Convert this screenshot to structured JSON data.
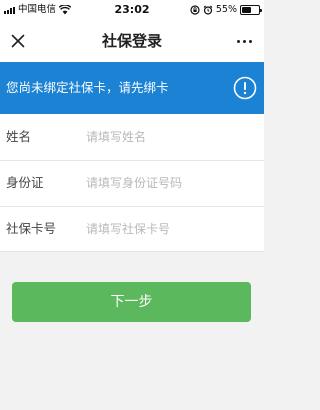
{
  "status_bar": {
    "carrier": "中国电信",
    "time": "23:02",
    "battery_percent": "55%",
    "battery_level": 0.55,
    "icons": [
      "signal-icon",
      "wifi-icon",
      "rotation-lock-icon",
      "alarm-icon",
      "battery-icon"
    ]
  },
  "nav": {
    "title": "社保登录",
    "close_icon": "close-icon",
    "more_icon": "more-icon"
  },
  "notice": {
    "text": "您尚未绑定社保卡，请先绑卡",
    "icon": "alert-icon",
    "background": "#1b82d4"
  },
  "form": {
    "rows": [
      {
        "label": "姓名",
        "placeholder": "请填写姓名",
        "value": ""
      },
      {
        "label": "身份证",
        "placeholder": "请填写身份证号码",
        "value": ""
      },
      {
        "label": "社保卡号",
        "placeholder": "请填写社保卡号",
        "value": ""
      }
    ]
  },
  "next_button": {
    "label": "下一步",
    "color": "#5cb85c"
  }
}
